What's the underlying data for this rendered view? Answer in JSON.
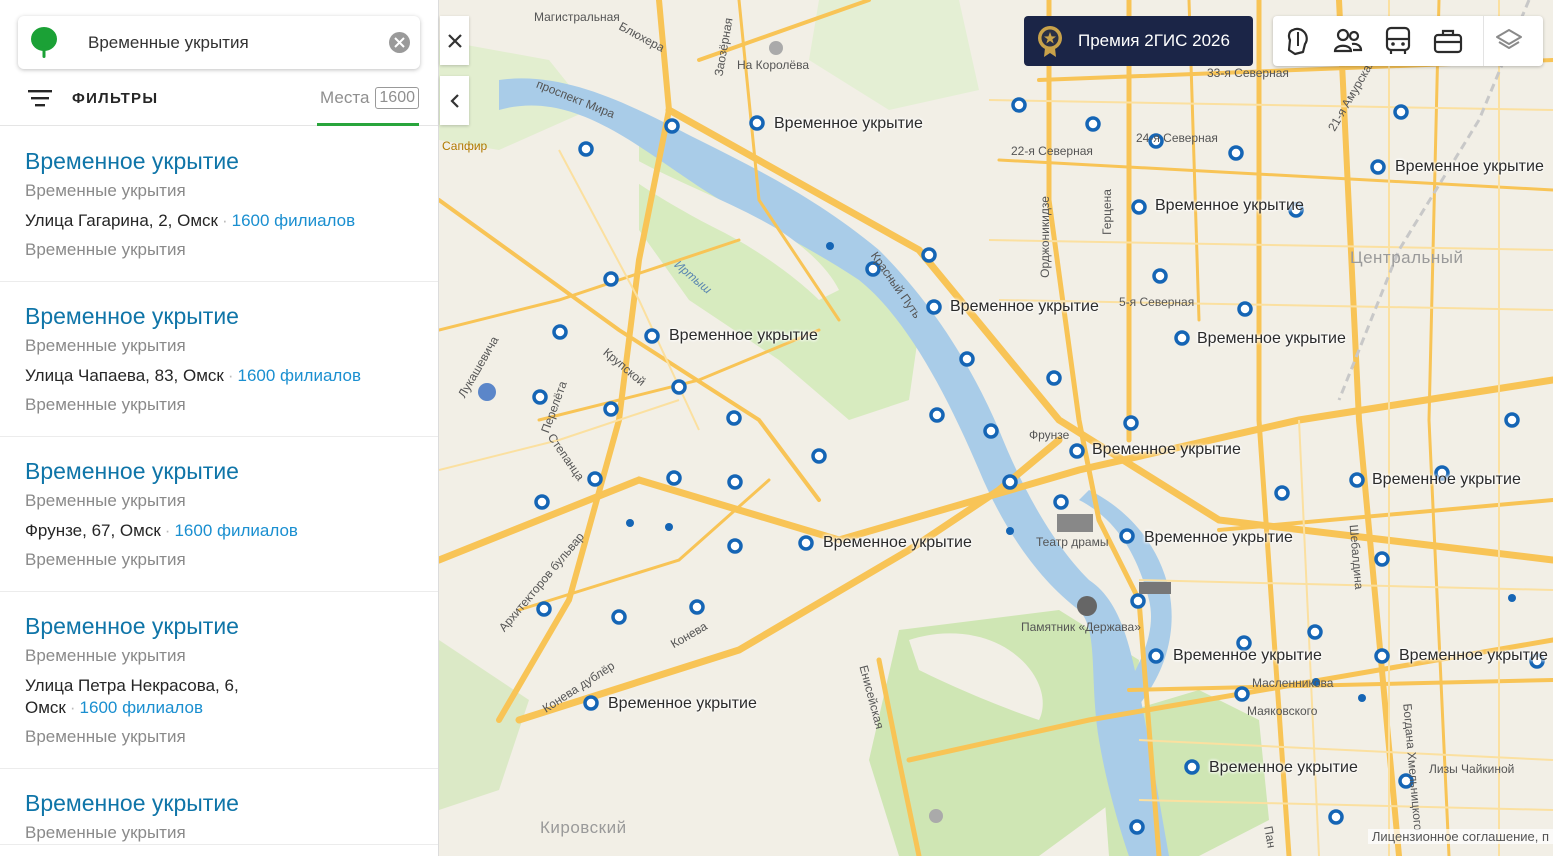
{
  "search": {
    "query": "Временные укрытия"
  },
  "filters": {
    "label": "ФИЛЬТРЫ",
    "places_label": "Места",
    "places_count": "1600"
  },
  "results": [
    {
      "title": "Временное укрытие",
      "category": "Временные укрытия",
      "address": "Улица Гагарина, 2, Омск",
      "branches": "1600 филиалов",
      "extra": "Временные укрытия"
    },
    {
      "title": "Временное укрытие",
      "category": "Временные укрытия",
      "address": "Улица Чапаева, 83, Омск",
      "branches": "1600 филиалов",
      "extra": "Временные укрытия"
    },
    {
      "title": "Временное укрытие",
      "category": "Временные укрытия",
      "address": "Фрунзе, 67, Омск",
      "branches": "1600 филиалов",
      "extra": "Временные укрытия"
    },
    {
      "title": "Временное укрытие",
      "category": "Временные укрытия",
      "address": "Улица Петра Некрасова, 6, Омск",
      "branches": "1600 филиалов",
      "extra": "Временные укрытия"
    },
    {
      "title": "Временное укрытие",
      "category": "Временные укрытия",
      "address": "",
      "branches": "",
      "extra": ""
    }
  ],
  "map": {
    "premium": "Премия 2ГИС 2026",
    "license": "Лицензионное соглашение, п",
    "districts": [
      "Центральный",
      "Кировский"
    ],
    "poi_label": "Временное укрытие",
    "streets": [
      "Магистральная",
      "Блюхера",
      "Заозёрная",
      "проспект Мира",
      "На Королёва",
      "Сапфир",
      "Иртыш",
      "Красный Путь",
      "22-я Северная",
      "24-я Северная",
      "33-я Северная",
      "21-я Амурская",
      "5-я Северная",
      "Орджоникидзе",
      "Герцена",
      "Лукашевича",
      "Крупской",
      "Перелёта",
      "Степанца",
      "Архитекторов бульвар",
      "Конева",
      "Конева дублёр",
      "Енисейская",
      "Фрунзе",
      "Театр драмы",
      "Памятник «Держава»",
      "Масленникова",
      "Маяковского",
      "Шебалдина",
      "Богдана Хмельницкого",
      "Лизы Чайкиной",
      "Пан"
    ],
    "colors": {
      "water": "#a9cce8",
      "park": "#cfe6b4",
      "road": "#f8c456",
      "background": "#f2efe6"
    }
  },
  "tools": [
    "attractions-icon",
    "friends-icon",
    "transport-icon",
    "business-icon",
    "layers-icon"
  ]
}
